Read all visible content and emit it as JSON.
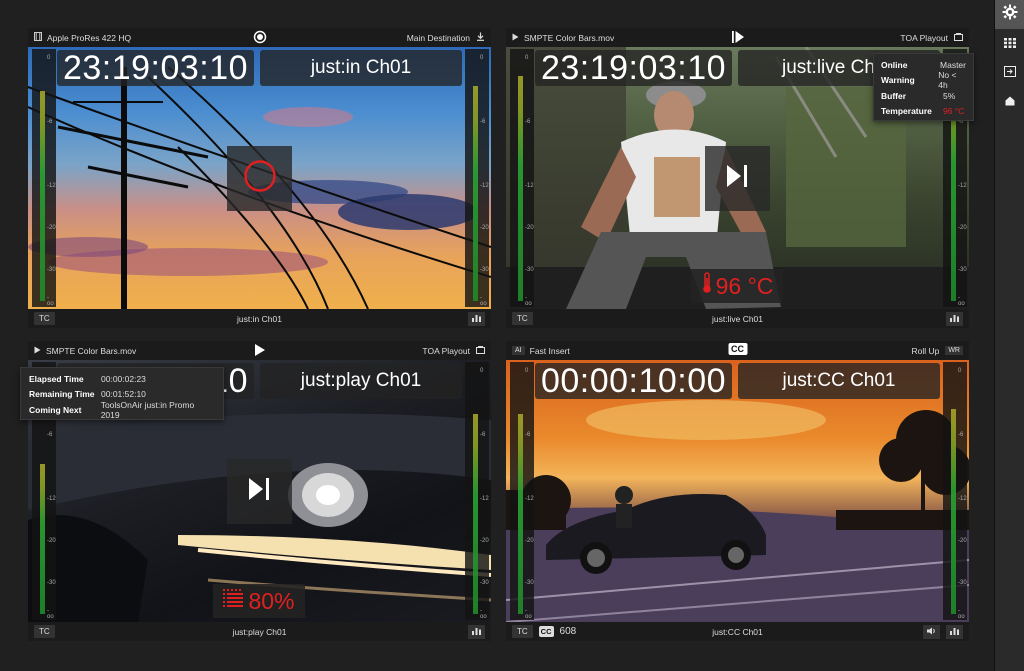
{
  "sidebar": {
    "buttons": [
      {
        "icon": "gear-icon",
        "active": true
      },
      {
        "icon": "grid-icon",
        "active": false
      },
      {
        "icon": "exit-icon",
        "active": false
      },
      {
        "icon": "home-icon",
        "active": false
      }
    ]
  },
  "meter_ticks": [
    "0",
    "-6",
    "-12",
    "-20",
    "-30",
    "-oo"
  ],
  "tiles": {
    "tl": {
      "top_left": "Apple ProRes 422 HQ",
      "top_right": "Main Destination",
      "timecode": "23:19:03:10",
      "name": "just:in Ch01",
      "bottom_tc": "TC",
      "bottom_name": "just:in Ch01"
    },
    "tr": {
      "top_left": "SMPTE Color Bars.mov",
      "top_right": "TOA Playout",
      "timecode": "23:19:03:10",
      "name": "just:live Ch01",
      "badge": "96 °C",
      "bottom_tc": "TC",
      "bottom_name": "just:live Ch01"
    },
    "bl": {
      "top_left": "SMPTE Color Bars.mov",
      "top_right": "TOA Playout",
      "timecode": "10",
      "name": "just:play Ch01",
      "badge": "80%",
      "bottom_tc": "TC",
      "bottom_name": "just:play Ch01"
    },
    "br": {
      "top_left_ai": "AI",
      "top_left": "Fast Insert",
      "top_cc": "CC",
      "top_right": "Roll Up",
      "top_right_badge": "WR",
      "timecode": "00:00:10:00",
      "name": "just:CC Ch01",
      "bottom_tc": "TC",
      "bottom_cc": "CC",
      "bottom_cc_num": "608",
      "bottom_name": "just:CC Ch01"
    }
  },
  "status_popover": {
    "rows": [
      {
        "label": "Online",
        "value": "Master"
      },
      {
        "label": "Warning",
        "value": "No < 4h"
      },
      {
        "label": "Buffer",
        "value": "5%"
      },
      {
        "label": "Temperature",
        "value": "96 °C"
      }
    ]
  },
  "time_popover": {
    "rows": [
      {
        "label": "Elapsed Time",
        "value": "00:00:02:23"
      },
      {
        "label": "Remaining Time",
        "value": "00:01:52:10"
      },
      {
        "label": "Coming Next",
        "value": "ToolsOnAir just:in Promo 2019"
      }
    ]
  },
  "colors": {
    "record_red": "#e02020",
    "meter_green": "#2aa332",
    "temperature_warning": "#e02020"
  }
}
